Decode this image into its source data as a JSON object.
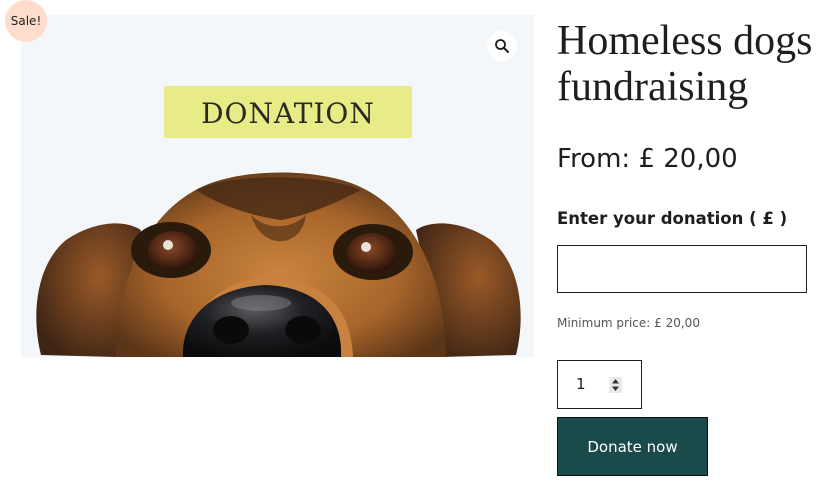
{
  "product": {
    "sale_badge": "Sale!",
    "title": "Homeless dogs fundraising",
    "price": "From: £ 20,00",
    "image": {
      "sign_text": "DONATION",
      "zoom_icon": "magnifier-icon"
    }
  },
  "donation": {
    "label": "Enter your donation ( £ )",
    "input_value": "",
    "min_price": "Minimum price: £ 20,00"
  },
  "quantity": {
    "value": "1",
    "spinner_icon": "up-down-arrows-icon"
  },
  "actions": {
    "donate_label": "Donate now"
  },
  "colors": {
    "sale_badge_bg": "#ffdccb",
    "sign_bg": "#e8ec86",
    "button_bg": "#1b4a4b"
  }
}
